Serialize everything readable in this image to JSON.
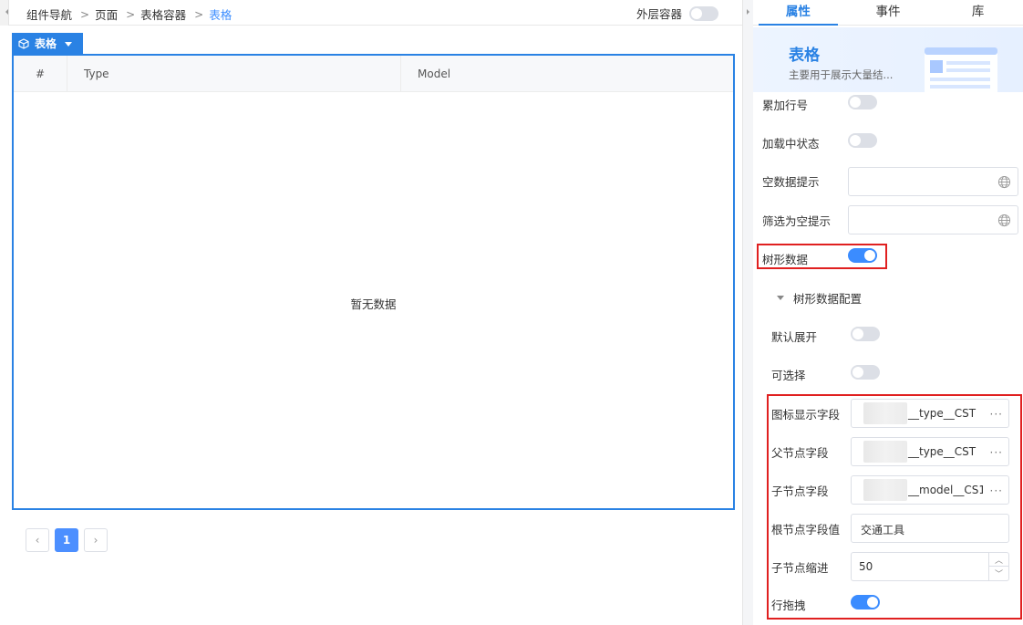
{
  "breadcrumb": [
    "组件导航",
    "页面",
    "表格容器",
    "表格"
  ],
  "outer_toggle": {
    "label": "外层容器",
    "on": false
  },
  "component_tag": {
    "label": "表格"
  },
  "table": {
    "columns": [
      "#",
      "Type",
      "Model"
    ],
    "empty_text": "暂无数据"
  },
  "pagination": {
    "prev": "‹",
    "current": "1",
    "next": "›"
  },
  "panel": {
    "tabs": [
      "属性",
      "事件",
      "库"
    ],
    "active_tab": "属性",
    "banner": {
      "title": "表格",
      "description": "主要用于展示大量结..."
    },
    "fields": {
      "cumulative_row_number": {
        "label": "累加行号",
        "on": false
      },
      "loading_state": {
        "label": "加载中状态",
        "on": false
      },
      "empty_data_tip": {
        "label": "空数据提示",
        "value": ""
      },
      "filter_empty_tip": {
        "label": "筛选为空提示",
        "value": ""
      },
      "tree_data": {
        "label": "树形数据",
        "on": true
      }
    },
    "tree_config": {
      "section_title": "树形数据配置",
      "default_expand": {
        "label": "默认展开",
        "on": false
      },
      "selectable": {
        "label": "可选择",
        "on": false
      },
      "icon_field": {
        "label": "图标显示字段",
        "value": "__type__CST"
      },
      "parent_field": {
        "label": "父节点字段",
        "value": "__type__CST"
      },
      "child_field": {
        "label": "子节点字段",
        "value": "__model__CS1"
      },
      "root_value": {
        "label": "根节点字段值",
        "value": "交通工具"
      },
      "child_indent": {
        "label": "子节点缩进",
        "value": "50"
      },
      "row_drag": {
        "label": "行拖拽",
        "on": true
      }
    }
  },
  "colors": {
    "accent": "#2a82e4",
    "highlight": "#e02020"
  }
}
